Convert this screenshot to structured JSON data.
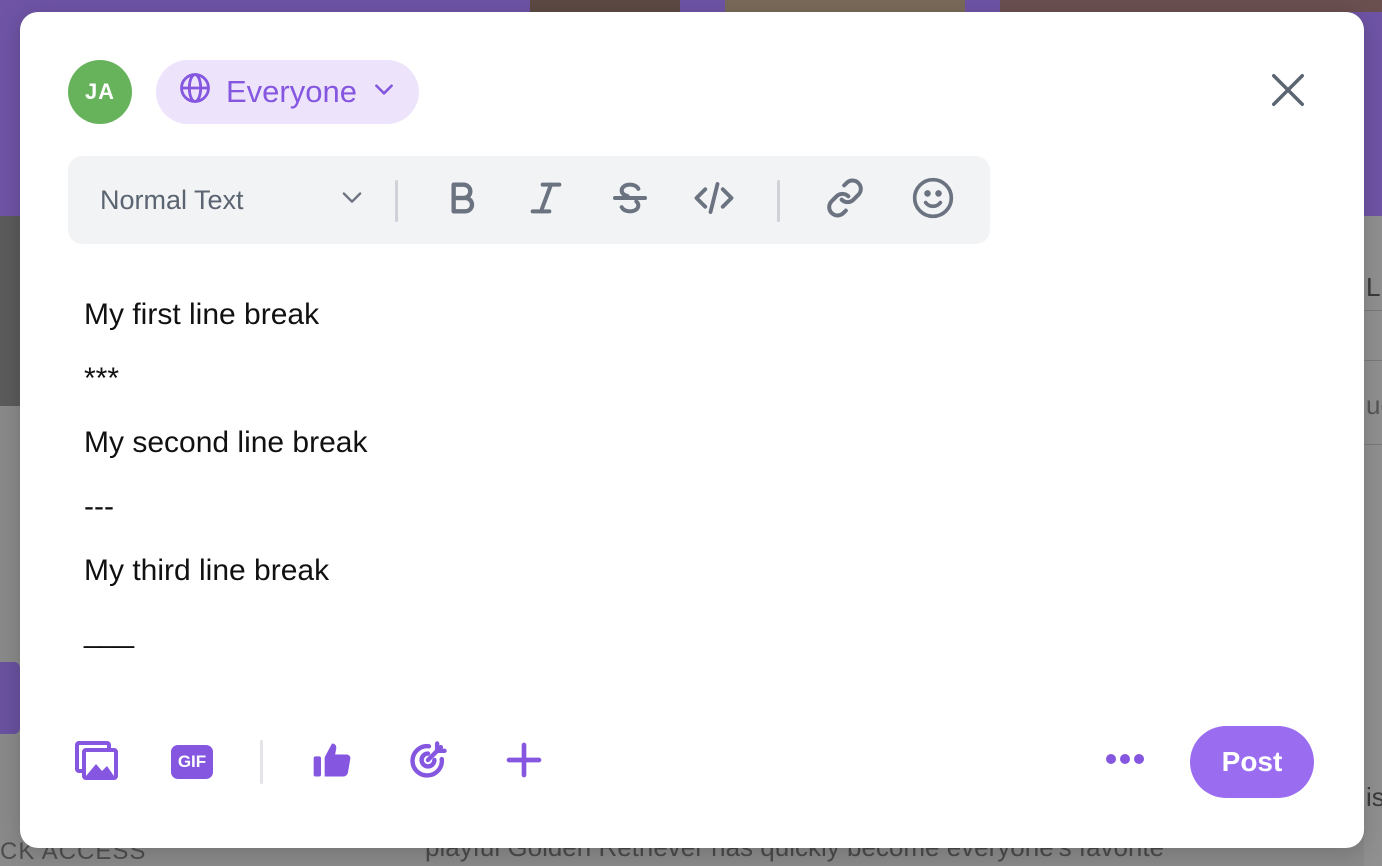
{
  "background": {
    "bottom_left_text": "CK ACCESS",
    "bottom_text": "playful Golden Retriever has quickly become everyone's favorite",
    "right_edge_text": [
      "L",
      "ue",
      "is"
    ]
  },
  "composer": {
    "avatar_initials": "JA",
    "audience_label": "Everyone",
    "icons": {
      "audience": "globe-icon",
      "audience_caret": "chevron-down-icon",
      "close": "close-icon"
    }
  },
  "toolbar": {
    "text_style": "Normal Text",
    "buttons": [
      "bold-icon",
      "italic-icon",
      "strikethrough-icon",
      "code-icon",
      "link-icon",
      "emoji-icon"
    ]
  },
  "editor": {
    "lines": [
      "My first line break",
      "***",
      "My second line break",
      "---",
      "My third line break",
      "___"
    ]
  },
  "footer": {
    "tools": [
      "image-gallery-icon",
      "gif-icon",
      "thumbs-up-icon",
      "target-icon",
      "plus-icon"
    ],
    "gif_label": "GIF",
    "post_label": "Post"
  },
  "colors": {
    "accent": "#9a6cf0",
    "accent_text": "#8556e0",
    "audience_bg": "#ede4fb",
    "avatar_bg": "#66b35c",
    "toolbar_bg": "#f2f3f5",
    "toolbar_icon": "#6b7280"
  }
}
